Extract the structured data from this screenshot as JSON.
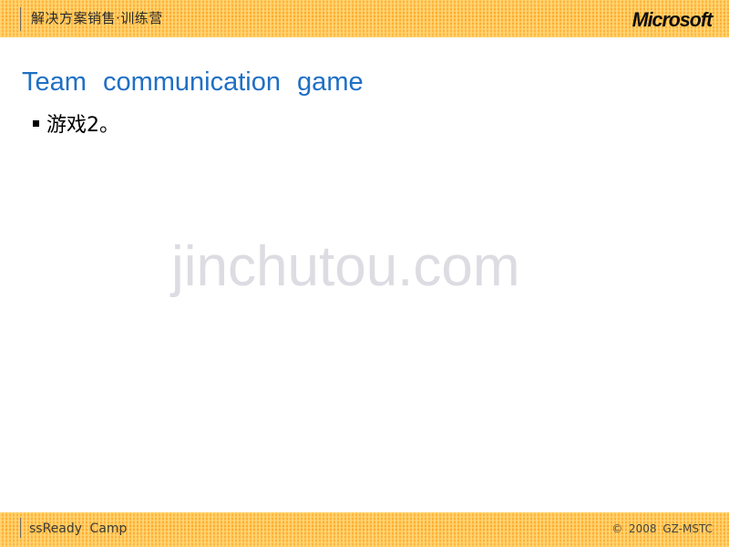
{
  "header": {
    "title": "解决方案销售·训练营",
    "logo_text": "Microsoft",
    "logo_mark": "·",
    "separator_icon": "vertical-rule-icon",
    "bar_color": "#ffae33"
  },
  "slide": {
    "title": "Team   communication   game",
    "title_color": "#1f6fc4",
    "bullets": [
      {
        "marker": "square-bullet-icon",
        "text": "游戏2。"
      }
    ],
    "background_color": "#ffffff"
  },
  "watermark": {
    "text": "jinchutou.com",
    "color": "#dcdce2"
  },
  "footer": {
    "left_text": "ssReady   Camp",
    "right_text": "© 2008  GZ-MSTC",
    "separator_icon": "vertical-rule-icon",
    "bar_color": "#ffae33"
  }
}
